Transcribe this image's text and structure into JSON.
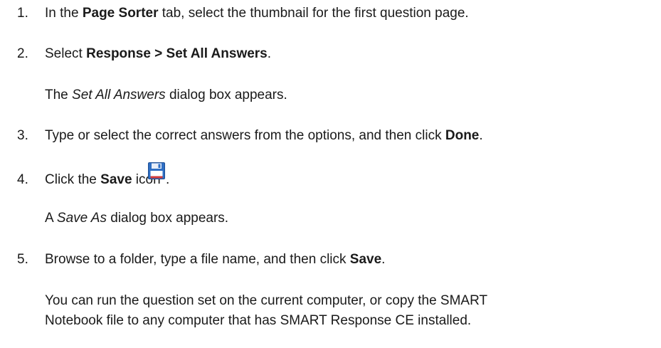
{
  "steps": [
    {
      "number": "1.",
      "parts": [
        {
          "t": "In the ",
          "style": "normal"
        },
        {
          "t": "Page Sorter",
          "style": "bold"
        },
        {
          "t": " tab, select the thumbnail for the first question page.",
          "style": "normal"
        }
      ]
    },
    {
      "number": "2.",
      "parts": [
        {
          "t": "Select ",
          "style": "normal"
        },
        {
          "t": "Response > Set All Answers",
          "style": "bold"
        },
        {
          "t": ".",
          "style": "normal"
        }
      ],
      "note_parts": [
        {
          "t": "The ",
          "style": "normal"
        },
        {
          "t": "Set All Answers",
          "style": "italic"
        },
        {
          "t": " dialog box appears.",
          "style": "normal"
        }
      ]
    },
    {
      "number": "3.",
      "parts": [
        {
          "t": "Type or select the correct answers from the options, and then click ",
          "style": "normal"
        },
        {
          "t": "Done",
          "style": "bold"
        },
        {
          "t": ".",
          "style": "normal"
        }
      ]
    },
    {
      "number": "4.",
      "parts": [
        {
          "t": "Click the ",
          "style": "normal"
        },
        {
          "t": "Save",
          "style": "bold"
        },
        {
          "t": " icon ",
          "style": "normal"
        }
      ],
      "trailing": ".",
      "icon": "save-icon",
      "note_parts": [
        {
          "t": "A ",
          "style": "normal"
        },
        {
          "t": "Save As",
          "style": "italic"
        },
        {
          "t": " dialog box appears.",
          "style": "normal"
        }
      ]
    },
    {
      "number": "5.",
      "parts": [
        {
          "t": "Browse to a folder, type a file name, and then click ",
          "style": "normal"
        },
        {
          "t": "Save",
          "style": "bold"
        },
        {
          "t": ".",
          "style": "normal"
        }
      ],
      "note_lines": [
        "You can run the question set on the current computer, or copy the SMART",
        "Notebook file to any computer that has SMART Response CE installed."
      ]
    }
  ],
  "colors": {
    "text": "#1a1a1a",
    "icon_blue": "#2f6fc4",
    "icon_red": "#d23a3a"
  }
}
